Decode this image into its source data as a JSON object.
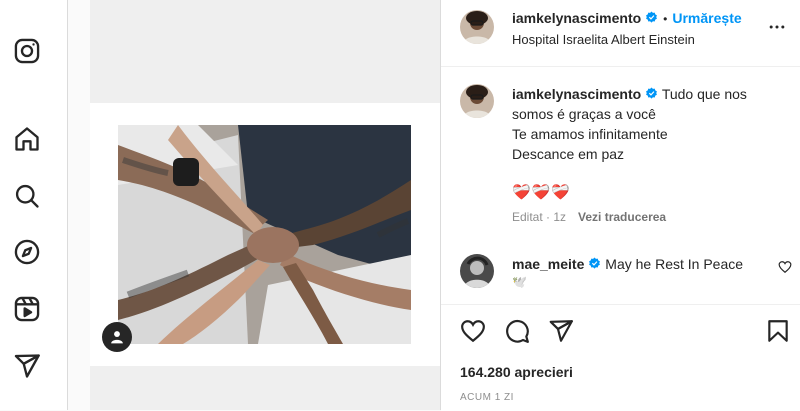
{
  "sidebar": {
    "items": [
      {
        "icon": "instagram-logo-icon"
      },
      {
        "icon": "home-icon"
      },
      {
        "icon": "search-icon"
      },
      {
        "icon": "explore-compass-icon"
      },
      {
        "icon": "reels-icon"
      },
      {
        "icon": "messages-send-icon"
      }
    ]
  },
  "post": {
    "author": {
      "username": "iamkelynascimento",
      "verified": true
    },
    "follow_label": "Urmărește",
    "location": "Hospital Israelita Albert Einstein",
    "caption": {
      "username": "iamkelynascimento",
      "lines": [
        "Tudo que nos",
        "somos é graças a você",
        "Te amamos infinitamente",
        "Descance em paz"
      ],
      "emoji": "❤️‍🩹❤️‍🩹❤️‍🩹"
    },
    "caption_meta": {
      "edited": "Editat · 1z",
      "translate": "Vezi traducerea"
    },
    "comment": {
      "username": "mae_meite",
      "verified": true,
      "text": "May he Rest In Peace",
      "emoji": "🕊️"
    },
    "likes": "164.280 aprecieri",
    "time_ago": "ACUM 1 ZI"
  },
  "colors": {
    "accent": "#0095f6",
    "verified": "#0095f6",
    "border": "#dbdbdb",
    "muted": "#8e8e8e"
  }
}
